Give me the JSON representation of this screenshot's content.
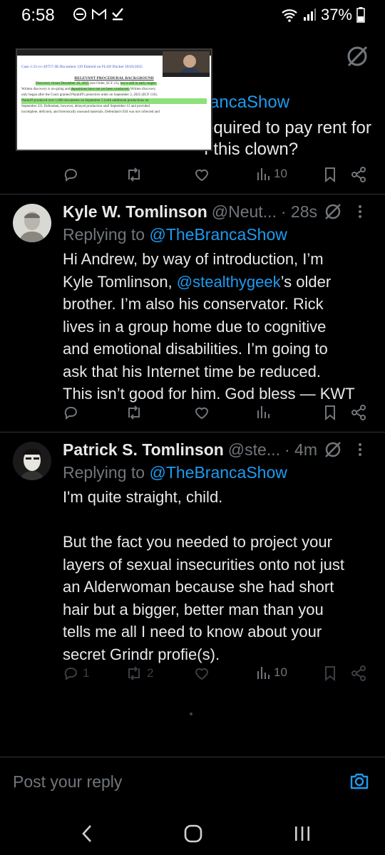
{
  "status_bar": {
    "time": "6:58",
    "battery": "37%"
  },
  "top_tweet": {
    "line1": "equired to pay rent for",
    "line2": "f this clown?",
    "replying_handle": "rancaShow",
    "views": "10"
  },
  "pip_video": {
    "case_line": "Case 1:25-cv-20757-JB   Document 139   Entered on FLSD Docket 10/03/2025",
    "heading": "RELEVANT PROCEDURAL BACKGROUND",
    "p1a": "Discovery closes December 16, 2025",
    "p1b": " (see Order, ECF 23), ",
    "p1c": "but is still in early stages.",
    "p2a": "Written discovery is on-going and ",
    "p2b": "depositions have not yet been conducted.",
    "p2c": " Written discovery",
    "p3": "only began after the Court granted Plaintiff's protective order on September 2, 2025 (ECF 116).",
    "p4": "Plaintiff produced over 1,000 documents on September 5 (with additional productions on",
    "p5": "September 22). Defendant, however, delayed production until September 12 and provided",
    "p6": "incomplete, deficient, and forensically unsound materials. Defendant's ESI was not collected and"
  },
  "tweets": [
    {
      "name": "Kyle W. Tomlinson",
      "handle": "@Neut...",
      "time": "· 28s",
      "replying_prefix": "Replying to ",
      "replying_to": "@TheBrancaShow",
      "body_lines": [
        "Hi Andrew, by way of introduction, I’m",
        "Kyle Tomlinson, ",
        "@stealthygeek",
        "’s older",
        "brother. I’m also his conservator. Rick",
        "lives in a group home due to cognitive",
        "and emotional disabilities. I’m going to",
        "ask that his Internet time be reduced.",
        "This isn’t good for him. God bless — KWT"
      ]
    },
    {
      "name": "Patrick S. Tomlinson",
      "handle": "@ste...",
      "time": "· 4m",
      "replying_prefix": "Replying to ",
      "replying_to": "@TheBrancaShow",
      "body_lines": [
        "I'm quite straight, child.",
        "",
        "But the fact you needed to project your",
        "layers of sexual insecurities onto not just",
        "an Alderwoman because she had short",
        "hair but a bigger, better man than you",
        "tells me all I need to know about your",
        "secret Grindr  profie(s)."
      ],
      "replies": "1",
      "reposts": "2",
      "views": "10"
    }
  ],
  "reply_composer": {
    "placeholder": "Post your reply"
  },
  "colors": {
    "accent": "#1d9bf0",
    "muted": "#71767b",
    "text": "#e7e9ea",
    "background": "#000000"
  }
}
